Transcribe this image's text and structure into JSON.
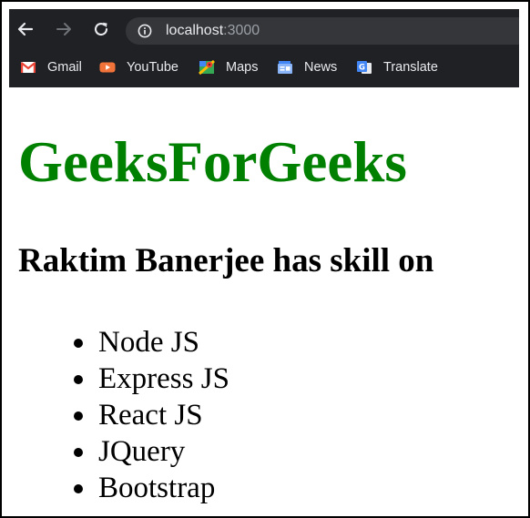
{
  "browser": {
    "url_host": "localhost",
    "url_port": ":3000",
    "icons": [
      "back-icon",
      "forward-icon",
      "reload-icon",
      "info-icon"
    ],
    "bookmarks": [
      {
        "label": "Gmail",
        "icon": "gmail-icon"
      },
      {
        "label": "YouTube",
        "icon": "youtube-icon"
      },
      {
        "label": "Maps",
        "icon": "maps-icon"
      },
      {
        "label": "News",
        "icon": "news-icon"
      },
      {
        "label": "Translate",
        "icon": "translate-icon"
      }
    ]
  },
  "page": {
    "title": "GeeksForGeeks",
    "title_color": "#008000",
    "subtitle": "Raktim Banerjee has skill on",
    "skills": [
      "Node JS",
      "Express JS",
      "React JS",
      "JQuery",
      "Bootstrap"
    ]
  }
}
